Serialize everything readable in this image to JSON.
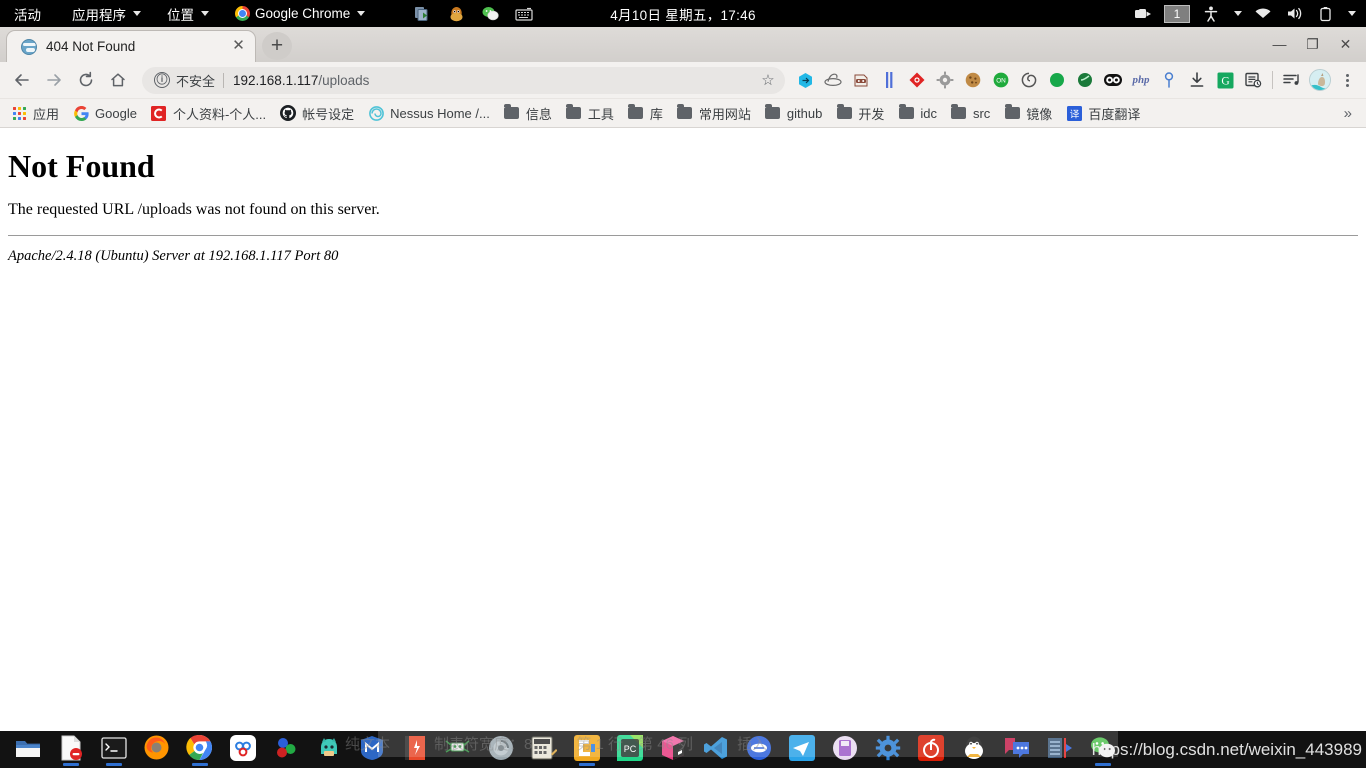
{
  "system_bar": {
    "activities": "活动",
    "applications": "应用程序",
    "places": "位置",
    "app_menu": "Google Chrome",
    "clock": "4月10日 星期五，17:46",
    "workspace": "1",
    "tray_icons": [
      "screen-share-icon",
      "qq-penguin-icon",
      "wechat-icon",
      "input-method-icon"
    ],
    "status_icons": [
      "screen-record-icon",
      "accessibility-icon",
      "wifi-icon",
      "volume-icon",
      "battery-icon"
    ]
  },
  "browser": {
    "tab": {
      "title": "404 Not Found",
      "favicon": "globe-icon",
      "close": "✕"
    },
    "new_tab": "+",
    "window_controls": {
      "minimize": "—",
      "maximize": "❐",
      "close": "✕"
    },
    "nav": {
      "back": "←",
      "forward": "→",
      "reload": "⟳",
      "home": "⌂"
    },
    "omnibox": {
      "info_icon": "ⓘ",
      "security_label": "不安全",
      "host": "192.168.1.117",
      "path": "/uploads",
      "star": "☆"
    },
    "extensions": [
      {
        "name": "ext-blue-cube",
        "glyph": "⬢",
        "color": "#22b8e6"
      },
      {
        "name": "ext-hat",
        "glyph": "◌",
        "color": "#6b6b6b"
      },
      {
        "name": "ext-bandit",
        "glyph": "▰",
        "color": "#8a4a3a"
      },
      {
        "name": "ext-pause-bars",
        "glyph": "❙❙",
        "color": "#4f6fd8"
      },
      {
        "name": "ext-red-diamond",
        "glyph": "◆",
        "color": "#e02424"
      },
      {
        "name": "ext-gear",
        "glyph": "⚙",
        "color": "#8a8a8a"
      },
      {
        "name": "ext-cookie",
        "glyph": "●",
        "color": "#b3762f"
      },
      {
        "name": "ext-on-toggle",
        "glyph": "ON",
        "color": "#1faa3c"
      },
      {
        "name": "ext-spiral",
        "glyph": "◎",
        "color": "#555555"
      },
      {
        "name": "ext-green-dot",
        "glyph": "●",
        "color": "#17a84a"
      },
      {
        "name": "ext-green-circle",
        "glyph": "●",
        "color": "#1b7a3a"
      },
      {
        "name": "ext-panda",
        "glyph": "◕◕",
        "color": "#111111"
      },
      {
        "name": "ext-php",
        "glyph": "php",
        "color": "#5a6aa8"
      },
      {
        "name": "ext-pin",
        "glyph": "⚲",
        "color": "#4a7fd0"
      },
      {
        "name": "ext-download",
        "glyph": "⤓",
        "color": "#3c4043"
      },
      {
        "name": "ext-grammarly",
        "glyph": "G",
        "color": "#15a85f"
      },
      {
        "name": "ext-reading-list",
        "glyph": "▤",
        "color": "#3c4043"
      }
    ],
    "profile_avatar": "avatar-icon",
    "menu": "⋮",
    "bookmarks": [
      {
        "label": "应用",
        "icon": "apps-grid-icon"
      },
      {
        "label": "Google",
        "icon": "google-icon"
      },
      {
        "label": "个人资料-个人...",
        "icon": "csdn-icon"
      },
      {
        "label": "帐号设定",
        "icon": "github-icon"
      },
      {
        "label": "Nessus Home /...",
        "icon": "nessus-icon"
      },
      {
        "label": "信息",
        "icon": "folder-icon"
      },
      {
        "label": "工具",
        "icon": "folder-icon"
      },
      {
        "label": "库",
        "icon": "folder-icon"
      },
      {
        "label": "常用网站",
        "icon": "folder-icon"
      },
      {
        "label": "github",
        "icon": "folder-icon"
      },
      {
        "label": "开发",
        "icon": "folder-icon"
      },
      {
        "label": "idc",
        "icon": "folder-icon"
      },
      {
        "label": "src",
        "icon": "folder-icon"
      },
      {
        "label": "镜像",
        "icon": "folder-icon"
      },
      {
        "label": "百度翻译",
        "icon": "baidu-translate-icon"
      }
    ],
    "bookmarks_overflow": "»"
  },
  "page": {
    "heading": "Not Found",
    "body": "The requested URL /uploads was not found on this server.",
    "signature": "Apache/2.4.18 (Ubuntu) Server at 192.168.1.117 Port 80"
  },
  "dock": {
    "items": [
      {
        "name": "files-icon",
        "running": false
      },
      {
        "name": "document-icon",
        "running": true
      },
      {
        "name": "terminal-icon",
        "running": true
      },
      {
        "name": "firefox-icon",
        "running": false
      },
      {
        "name": "chrome-icon",
        "running": true
      },
      {
        "name": "baidu-netdisk-icon",
        "running": false
      },
      {
        "name": "three-circles-icon",
        "running": false
      },
      {
        "name": "green-character-icon",
        "running": false
      },
      {
        "name": "maxthon-icon",
        "running": false
      },
      {
        "name": "red-book-icon",
        "running": false
      },
      {
        "name": "spider-icon",
        "running": false
      },
      {
        "name": "disc-icon",
        "running": false
      },
      {
        "name": "calculator-icon",
        "running": false
      },
      {
        "name": "everything-icon",
        "running": true
      },
      {
        "name": "pycharm-icon",
        "running": false
      },
      {
        "name": "cube-icon",
        "running": false
      },
      {
        "name": "vscode-icon",
        "running": false
      },
      {
        "name": "blue-circle-icon",
        "running": false
      },
      {
        "name": "telegram-icon",
        "running": false
      },
      {
        "name": "purple-disk-icon",
        "running": false
      },
      {
        "name": "settings-gear-icon",
        "running": false
      },
      {
        "name": "netease-music-icon",
        "running": false
      },
      {
        "name": "qq-icon",
        "running": false
      },
      {
        "name": "chat-icon",
        "running": false
      },
      {
        "name": "audio-editor-icon",
        "running": false
      },
      {
        "name": "wechat-icon",
        "running": true
      }
    ]
  },
  "overlays": {
    "watermark": "https://blog.csdn.net/weixin_443989",
    "editor_status": [
      "纯文本",
      "制表符宽度：8",
      "第 1 行，第 46 列",
      "插入"
    ]
  },
  "colors": {
    "accent": "#4285f4",
    "topbar_bg": "#000000",
    "chrome_toolbar": "#f3f1ef",
    "dock_bg": "#121212"
  }
}
